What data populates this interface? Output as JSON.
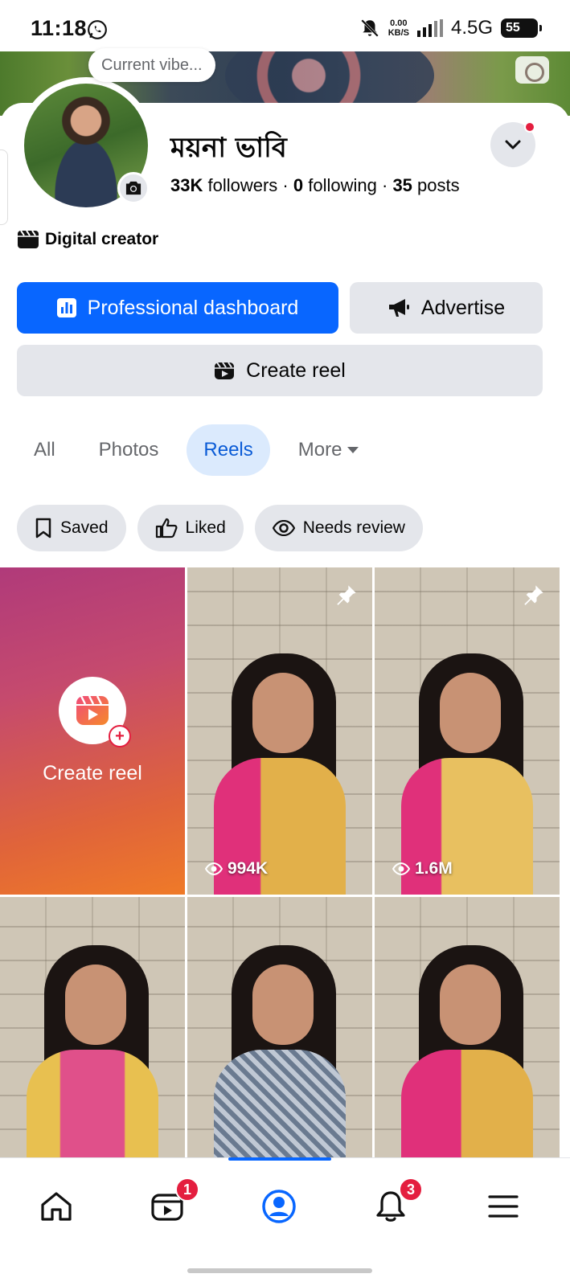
{
  "status_bar": {
    "time": "11:18",
    "speed_value": "0.00",
    "speed_unit": "KB/S",
    "network": "4.5G",
    "battery": "55"
  },
  "profile": {
    "vibe_prompt": "Current vibe...",
    "name": "ময়না ভাবি",
    "followers_count": "33K",
    "followers_label": "followers",
    "following_count": "0",
    "following_label": "following",
    "posts_count": "35",
    "posts_label": "posts",
    "category": "Digital creator"
  },
  "actions": {
    "professional_dashboard": "Professional dashboard",
    "advertise": "Advertise",
    "create_reel": "Create reel"
  },
  "tabs": [
    {
      "label": "All",
      "active": false
    },
    {
      "label": "Photos",
      "active": false
    },
    {
      "label": "Reels",
      "active": true
    },
    {
      "label": "More",
      "active": false
    }
  ],
  "filters": [
    {
      "label": "Saved",
      "icon": "bookmark-icon"
    },
    {
      "label": "Liked",
      "icon": "thumbs-up-icon"
    },
    {
      "label": "Needs review",
      "icon": "eye-icon"
    }
  ],
  "grid": {
    "create_label": "Create reel",
    "reels": [
      {
        "views": "994K",
        "pinned": true
      },
      {
        "views": "1.6M",
        "pinned": true
      },
      {
        "views": "",
        "pinned": false
      },
      {
        "views": "",
        "pinned": false
      },
      {
        "views": "",
        "pinned": false
      }
    ]
  },
  "bottom_nav": {
    "video_badge": "1",
    "notifications_badge": "3"
  },
  "colors": {
    "accent": "#0866ff",
    "badge": "#e41e3f",
    "chip_bg": "#e4e6eb",
    "active_tab_bg": "#dbeafd"
  }
}
